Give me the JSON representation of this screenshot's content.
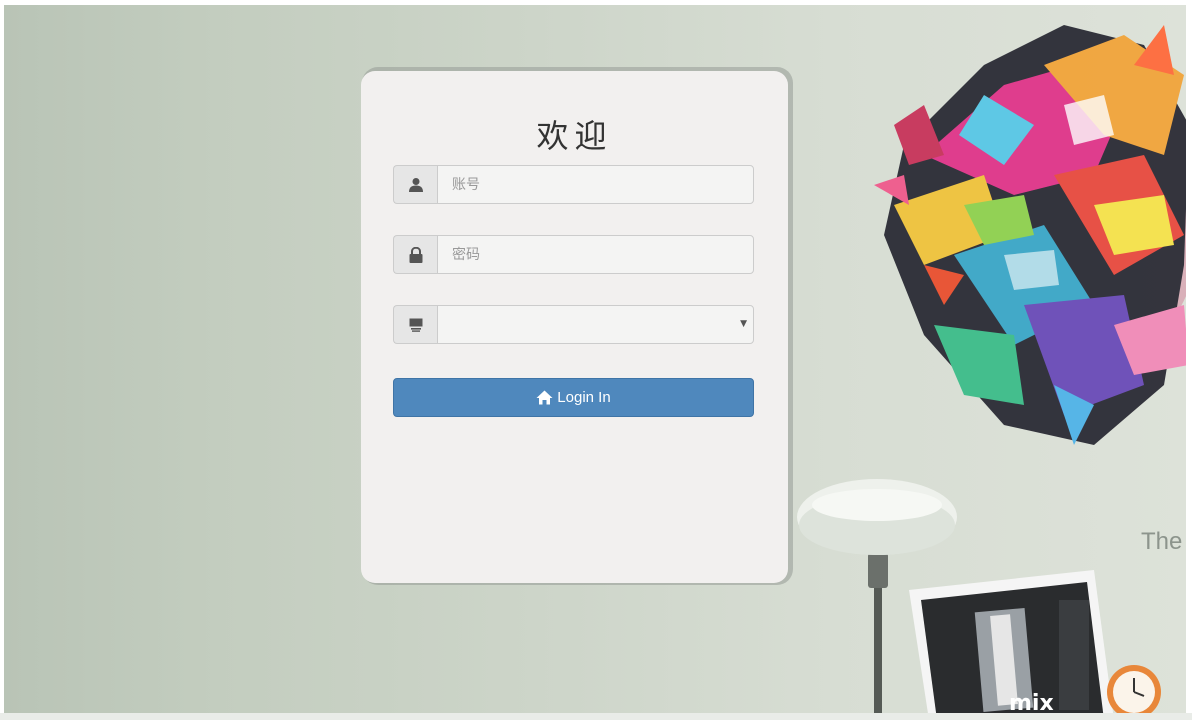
{
  "login": {
    "title": "欢迎",
    "account_placeholder": "账号",
    "password_placeholder": "密码",
    "select_value": "",
    "button_label": "Login In",
    "icons": {
      "account": "user-icon",
      "password": "lock-icon",
      "select": "monitor-icon",
      "button": "home-icon",
      "select_arrow": "caret-down-icon"
    }
  },
  "background": {
    "partial_text": "The"
  },
  "colors": {
    "button": "#4f88bd",
    "card": "#f2f0ef",
    "background": "#cdd5c9"
  }
}
